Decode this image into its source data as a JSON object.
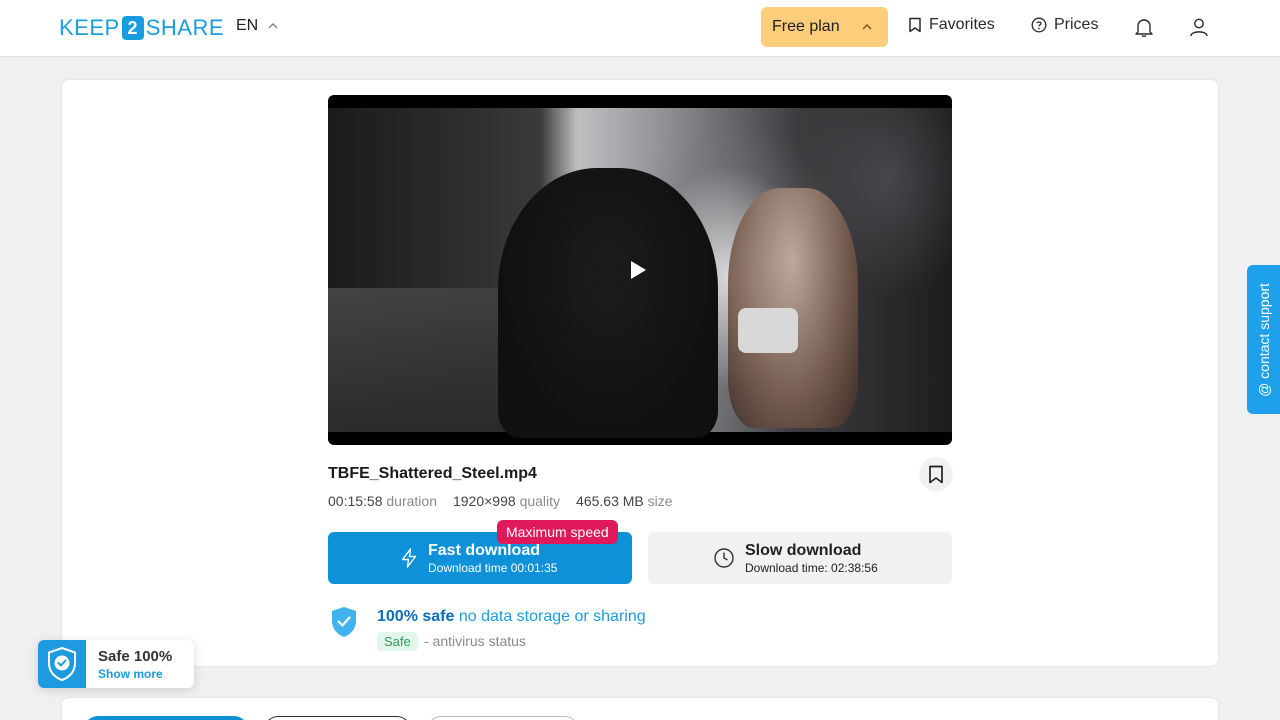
{
  "header": {
    "logo_left": "KEEP",
    "logo_mid": "2",
    "logo_right": "SHARE",
    "language": "EN",
    "plan": "Free plan",
    "favorites": "Favorites",
    "prices": "Prices"
  },
  "file": {
    "name": "TBFE_Shattered_Steel.mp4",
    "duration_value": "00:15:58",
    "duration_label": "duration",
    "quality_value": "1920×998",
    "quality_label": "quality",
    "size_value": "465.63 MB",
    "size_label": "size"
  },
  "download": {
    "badge": "Maximum speed",
    "fast_title": "Fast download",
    "fast_sub": "Download time 00:01:35",
    "slow_title": "Slow download",
    "slow_sub": "Download time: 02:38:56"
  },
  "safety": {
    "title_bold": "100% safe",
    "title_rest": "no data storage or sharing",
    "tag": "Safe",
    "status": "- antivirus status"
  },
  "support": {
    "label": "@ contact support"
  },
  "safe_widget": {
    "title": "Safe 100%",
    "link": "Show more"
  },
  "icons": [
    "chevron-up-icon",
    "bookmark-icon",
    "help-circle-icon",
    "bell-icon",
    "user-icon",
    "play-icon",
    "lightning-icon",
    "clock-icon",
    "shield-check-icon"
  ],
  "colors": {
    "accent": "#0e91d9",
    "plan": "#fccd7a",
    "badge": "#e0195a",
    "safe_green": "#2f9a5a"
  }
}
